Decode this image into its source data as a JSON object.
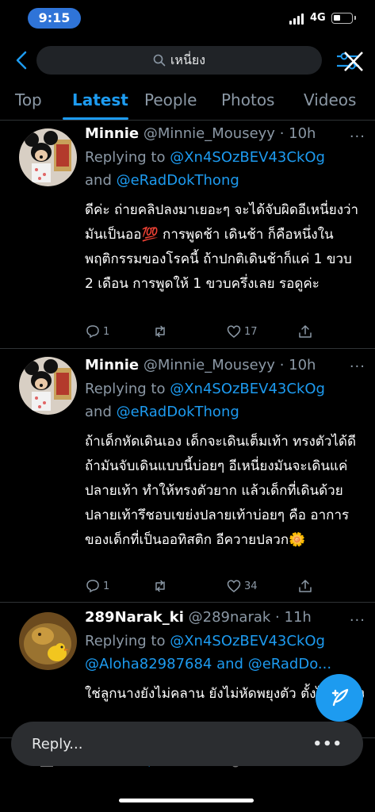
{
  "status_bar": {
    "time": "9:15",
    "network": "4G",
    "battery_percent": 40
  },
  "search": {
    "query": "เหนี่ยง"
  },
  "tabs": [
    {
      "label": "Top",
      "active": false
    },
    {
      "label": "Latest",
      "active": true
    },
    {
      "label": "People",
      "active": false
    },
    {
      "label": "Photos",
      "active": false
    },
    {
      "label": "Videos",
      "active": false
    }
  ],
  "tweets": [
    {
      "name": "Minnie",
      "handle": "@Minnie_Mouseyy",
      "time": "· 10h",
      "replying_prefix": "Replying to ",
      "mention1": "@Xn4SOzBEV43CkOg",
      "and1": "and ",
      "mention2": "@eRadDokThong",
      "text": "ดีค่ะ ถ่ายคลิปลงมาเยอะๆ จะได้จับผิดอีเหนี่ยงว่ามันเป็นออ💯 การพูดช้า เดินช้า ก็คือหนึ่งในพฤติกรรมของโรคนี้ ถ้าปกติเดินช้าก็แค่ 1 ขวบ 2 เดือน การพูดให้ 1 ขวบครึ่งเลย รอดูค่ะ",
      "replies": "1",
      "retweets": "",
      "likes": "17"
    },
    {
      "name": "Minnie",
      "handle": "@Minnie_Mouseyy",
      "time": "· 10h",
      "replying_prefix": "Replying to ",
      "mention1": "@Xn4SOzBEV43CkOg",
      "and1": "and ",
      "mention2": "@eRadDokThong",
      "text": "ถ้าเด็กหัดเดินเอง เด็กจะเดินเต็มเท้า ทรงตัวได้ดี ถ้ามันจับเดินแบบนี้บ่อยๆ อีเหนี่ยงมันจะเดินแค่ปลายเท้า ทำให้ทรงตัวยาก แล้วเด็กที่เดินด้วยปลายเท้ารึชอบเขย่งปลายเท้าบ่อยๆ คือ อาการของเด็กที่เป็นออทิสติก อีควายปลวก🌼",
      "replies": "1",
      "retweets": "",
      "likes": "34"
    },
    {
      "name": "289Narak_ki",
      "handle": "@289narak",
      "time": "· 11h",
      "replying_prefix": "Replying to ",
      "mention1": "@Xn4SOzBEV43CkOg",
      "and1": "",
      "mention2": "@Aloha82987684 and @eRadDo...",
      "text": "ใช่ลูกนางยังไม่คลาน ยังไม่หัดพยุงตัว ตั้งไข่ กล้ามเนื้อส้นขารวมเท้ามีปัญ..."
    }
  ],
  "more_label": "···",
  "reply_bar": {
    "placeholder": "Reply...",
    "more": "•••"
  },
  "colors": {
    "accent": "#1d9bf0",
    "background": "#000000",
    "secondary_text": "#8b98a5"
  }
}
